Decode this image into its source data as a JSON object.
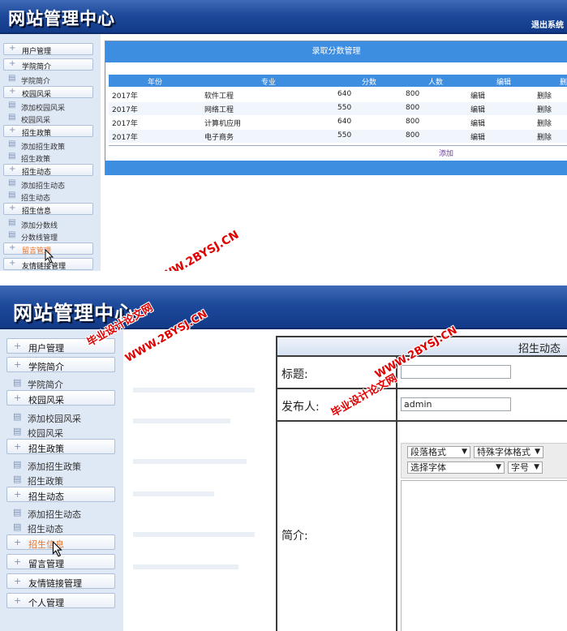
{
  "brand": "网站管理中心",
  "logout_label": "退出系统",
  "score_panel": {
    "title": "录取分数管理",
    "columns": [
      "年份",
      "专业",
      "分数",
      "人数",
      "编辑",
      "删除"
    ],
    "rows": [
      {
        "year": "2017年",
        "major": "软件工程",
        "score": "640",
        "count": "800",
        "edit": "编辑",
        "delete": "删除"
      },
      {
        "year": "2017年",
        "major": "网络工程",
        "score": "550",
        "count": "800",
        "edit": "编辑",
        "delete": "删除"
      },
      {
        "year": "2017年",
        "major": "计算机应用",
        "score": "640",
        "count": "800",
        "edit": "编辑",
        "delete": "删除"
      },
      {
        "year": "2017年",
        "major": "电子商务",
        "score": "550",
        "count": "800",
        "edit": "编辑",
        "delete": "删除"
      }
    ],
    "add_label": "添加"
  },
  "sidebar1": [
    {
      "label": "用户管理"
    },
    {
      "label": "学院简介"
    },
    {
      "label": "学院简介"
    },
    {
      "label": "校园风采"
    },
    {
      "label": "添加校园风采"
    },
    {
      "label": "校园风采"
    },
    {
      "label": "招生政策"
    },
    {
      "label": "添加招生政策"
    },
    {
      "label": "招生政策"
    },
    {
      "label": "招生动态"
    },
    {
      "label": "添加招生动态"
    },
    {
      "label": "招生动态"
    },
    {
      "label": "招生信息"
    },
    {
      "label": "添加分数线"
    },
    {
      "label": "分数线管理"
    },
    {
      "label": "留言管理"
    },
    {
      "label": "友情链接管理"
    }
  ],
  "sidebar2": [
    {
      "label": "用户管理"
    },
    {
      "label": "学院简介"
    },
    {
      "label": "学院简介"
    },
    {
      "label": "校园风采"
    },
    {
      "label": "添加校园风采"
    },
    {
      "label": "校园风采"
    },
    {
      "label": "招生政策"
    },
    {
      "label": "添加招生政策"
    },
    {
      "label": "招生政策"
    },
    {
      "label": "招生动态"
    },
    {
      "label": "添加招生动态"
    },
    {
      "label": "招生动态"
    },
    {
      "label": "招生信息"
    },
    {
      "label": "留言管理"
    },
    {
      "label": "友情链接管理"
    },
    {
      "label": "个人管理"
    }
  ],
  "news_form": {
    "title": "招生动态",
    "title_label": "标题:",
    "title_value": "",
    "publisher_label": "发布人:",
    "publisher_value": "admin",
    "intro_label": "简介:",
    "toolbar": {
      "paragraph": "段落格式",
      "special": "特殊字体格式",
      "font": "选择字体",
      "size": "字号"
    }
  },
  "watermark": {
    "site": "WWW.2BYSJ.CN",
    "name": "毕业设计论文网",
    "color": "#e00000"
  },
  "colors": {
    "header": "#1e4a9c",
    "bar": "#3d8de0",
    "sidebar": "#dfe8f5",
    "active": "#e8742a"
  }
}
